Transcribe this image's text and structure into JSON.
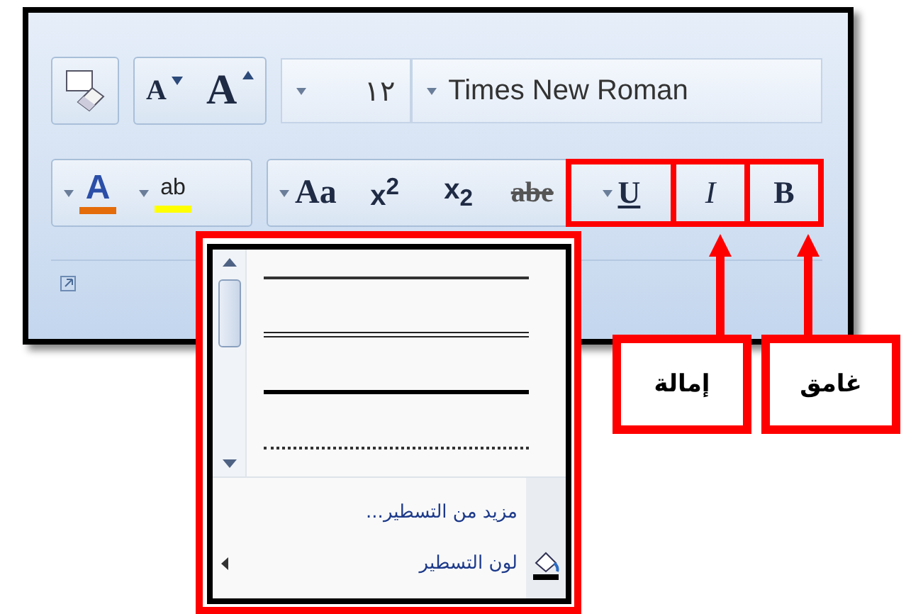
{
  "ribbon": {
    "grow_shrink": [
      {
        "kind": "grow",
        "label": "A"
      },
      {
        "kind": "shrink",
        "label": "A"
      }
    ],
    "size_box": {
      "value": "١٢"
    },
    "font_box": {
      "value": "Times New Roman"
    },
    "color_buttons": [
      {
        "kind": "highlight",
        "label": "ab",
        "color": "#ffff00"
      },
      {
        "kind": "font_color",
        "label": "A",
        "color": "#e46c0a"
      }
    ],
    "format_buttons": [
      {
        "kind": "bold",
        "label": "B",
        "highlighted": true
      },
      {
        "kind": "italic",
        "label": "I",
        "highlighted": true
      },
      {
        "kind": "underline",
        "label": "U",
        "highlighted": true
      },
      {
        "kind": "strike",
        "label": "abe",
        "highlighted": false
      },
      {
        "kind": "subscript",
        "label": "x$_{2}$",
        "highlighted": false
      },
      {
        "kind": "superscript",
        "label": "x$^{2}$",
        "highlighted": false
      },
      {
        "kind": "case",
        "label": "Aa",
        "highlighted": false
      }
    ]
  },
  "underline_menu": {
    "styles": [
      {
        "kind": "single"
      },
      {
        "kind": "double"
      },
      {
        "kind": "thick"
      },
      {
        "kind": "dotted"
      }
    ],
    "items": [
      {
        "label": "مزيد من التسطير...",
        "submenu": false
      },
      {
        "label": "لون التسطير",
        "submenu": true
      }
    ]
  },
  "callouts": [
    {
      "text": "غامق"
    },
    {
      "text": "إمالة"
    }
  ]
}
